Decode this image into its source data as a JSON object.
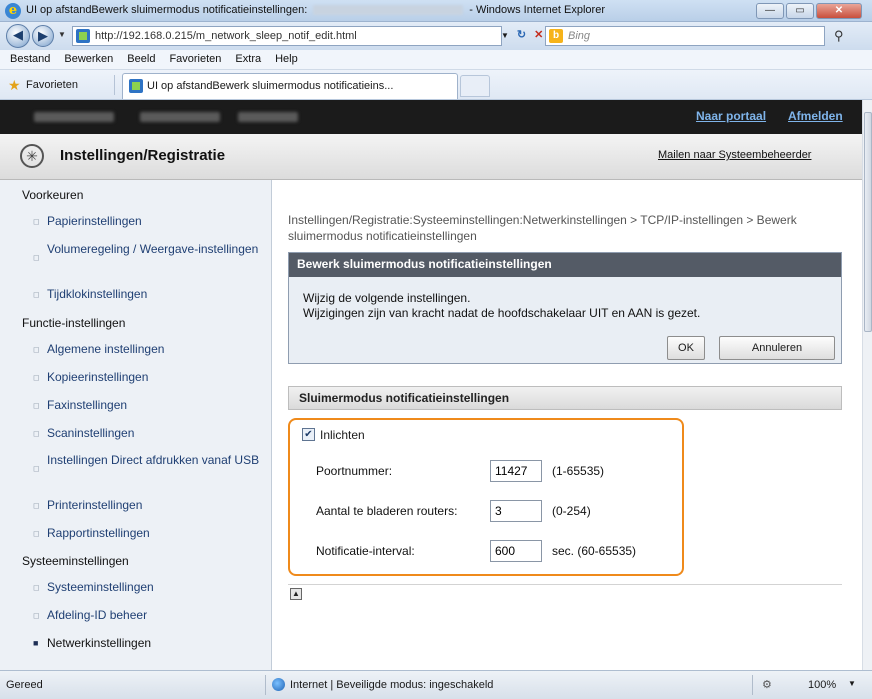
{
  "window": {
    "title_prefix": "UI op afstandBewerk sluimermodus notificatieinstellingen:",
    "title_suffix": "- Windows Internet Explorer",
    "minimize": "—",
    "maximize": "▭",
    "close": "✕"
  },
  "address": {
    "url": "http://192.168.0.215/m_network_sleep_notif_edit.html",
    "search_placeholder": "Bing",
    "search_engine_letter": "b"
  },
  "menu": [
    "Bestand",
    "Bewerken",
    "Beeld",
    "Favorieten",
    "Extra",
    "Help"
  ],
  "favorites": {
    "label": "Favorieten",
    "tab_title": "UI op afstandBewerk sluimermodus notificatieins..."
  },
  "portal": {
    "portal_link": "Naar portaal",
    "logout_link": "Afmelden"
  },
  "section": {
    "title": "Instellingen/Registratie",
    "mail_admin": "Mailen naar Systeembeheerder"
  },
  "sidebar": {
    "groups": [
      {
        "label": "Voorkeuren",
        "items": [
          "Papierinstellingen",
          "Volumeregeling / Weergave-instellingen",
          "Tijdklokinstellingen"
        ]
      },
      {
        "label": "Functie-instellingen",
        "items": [
          "Algemene instellingen",
          "Kopieerinstellingen",
          "Faxinstellingen",
          "Scaninstellingen",
          "Instellingen Direct afdrukken vanaf USB",
          "Printerinstellingen",
          "Rapportinstellingen"
        ]
      },
      {
        "label": "Systeeminstellingen",
        "items": [
          "Systeeminstellingen",
          "Afdeling-ID beheer",
          "Netwerkinstellingen"
        ]
      }
    ]
  },
  "breadcrumb": "Instellingen/Registratie:Systeeminstellingen:Netwerkinstellingen > TCP/IP-instellingen > Bewerk sluimermodus notificatieinstellingen",
  "edit_panel": {
    "title": "Bewerk sluimermodus notificatieinstellingen",
    "line1": "Wijzig de volgende instellingen.",
    "line2": "Wijzigingen zijn van kracht nadat de hoofdschakelaar UIT en AAN is gezet.",
    "ok": "OK",
    "cancel": "Annuleren"
  },
  "settings": {
    "header": "Sluimermodus notificatieinstellingen",
    "notify_label": "Inlichten",
    "notify_checked": true,
    "port_label": "Poortnummer:",
    "port_value": "11427",
    "port_range": "(1-65535)",
    "routers_label": "Aantal te bladeren routers:",
    "routers_value": "3",
    "routers_range": "(0-254)",
    "interval_label": "Notificatie-interval:",
    "interval_value": "600",
    "interval_range": "sec. (60-65535)"
  },
  "status": {
    "left": "Gereed",
    "zone": "Internet | Beveiligde modus: ingeschakeld",
    "zoom": "100%"
  }
}
